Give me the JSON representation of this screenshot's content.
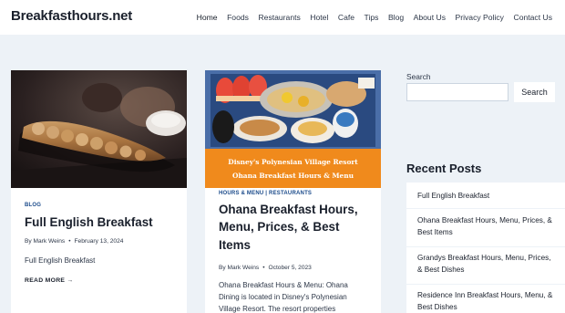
{
  "site": {
    "name": "Breakfasthours.net"
  },
  "nav": {
    "items": [
      {
        "label": "Home"
      },
      {
        "label": "Foods"
      },
      {
        "label": "Restaurants"
      },
      {
        "label": "Hotel"
      },
      {
        "label": "Cafe"
      },
      {
        "label": "Tips"
      },
      {
        "label": "Blog"
      },
      {
        "label": "About Us"
      },
      {
        "label": "Privacy Policy"
      },
      {
        "label": "Contact Us"
      }
    ]
  },
  "posts": [
    {
      "category": "BLOG",
      "title": "Full English Breakfast",
      "author": "By Mark Weins",
      "date": "February 13, 2024",
      "excerpt": "Full English Breakfast",
      "read_more": "READ MORE →"
    },
    {
      "category_a": "HOURS & MENU",
      "category_sep": "|",
      "category_b": "RESTAURANTS",
      "title_lines": [
        "Ohana Breakfast Hours,",
        "Menu, Prices, & Best",
        "Items"
      ],
      "author": "By Mark Weins",
      "date": "October 5, 2023",
      "excerpt_lines": [
        "Ohana Breakfast Hours & Menu: Ohana",
        "Dining is located in Disney's Polynesian",
        "Village Resort. The resort properties"
      ],
      "thumb_text_1": "Disney's Polynesian Village Resort",
      "thumb_text_2": "Ohana Breakfast Hours & Menu"
    }
  ],
  "sidebar": {
    "search_label": "Search",
    "search_placeholder": "",
    "search_button": "Search",
    "recent_title": "Recent Posts",
    "recent_posts": [
      {
        "lines": [
          "Full English Breakfast"
        ]
      },
      {
        "lines": [
          "Ohana Breakfast Hours, Menu, Prices, &",
          "Best Items"
        ]
      },
      {
        "lines": [
          "Grandys Breakfast Hours, Menu, Prices,",
          "& Best Dishes"
        ]
      },
      {
        "lines": [
          "Residence Inn Breakfast Hours, Menu, &",
          "Best Dishes"
        ]
      }
    ]
  },
  "colors": {
    "background": "#edf2f7",
    "card": "#ffffff",
    "category": "#1a4a8a",
    "thumb_banner": "#f08a1c"
  }
}
